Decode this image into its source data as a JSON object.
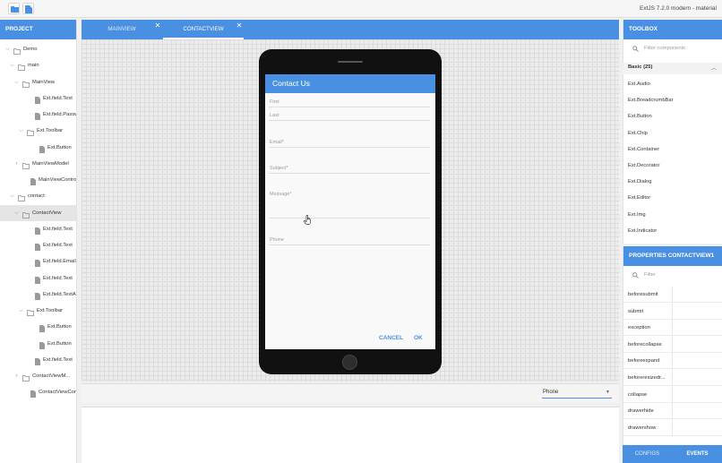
{
  "app": {
    "title": "ExtJS 7.2.0 modern - material"
  },
  "project": {
    "header": "PROJECT",
    "tree": [
      {
        "label": "Demo",
        "level": 0,
        "kind": "folder",
        "expanded": true
      },
      {
        "label": "main",
        "level": 1,
        "kind": "folder",
        "expanded": true
      },
      {
        "label": "MainView",
        "level": 2,
        "kind": "folder",
        "expanded": true
      },
      {
        "label": "Ext.field.Text",
        "level": 3,
        "kind": "file"
      },
      {
        "label": "Ext.field.Passw...",
        "level": 3,
        "kind": "file"
      },
      {
        "label": "Ext.Toolbar",
        "level": 3,
        "kind": "folder",
        "expanded": true
      },
      {
        "label": "Ext.Button",
        "level": 4,
        "kind": "file"
      },
      {
        "label": "MainViewModel",
        "level": 2,
        "kind": "folder",
        "expanded": false
      },
      {
        "label": "MainViewController",
        "level": 2,
        "kind": "file"
      },
      {
        "label": "contact",
        "level": 1,
        "kind": "folder",
        "expanded": true
      },
      {
        "label": "ContactView",
        "level": 2,
        "kind": "folder",
        "expanded": true,
        "selected": true
      },
      {
        "label": "Ext.field.Text",
        "level": 3,
        "kind": "file"
      },
      {
        "label": "Ext.field.Text",
        "level": 3,
        "kind": "file"
      },
      {
        "label": "Ext.field.Email",
        "level": 3,
        "kind": "file"
      },
      {
        "label": "Ext.field.Text",
        "level": 3,
        "kind": "file"
      },
      {
        "label": "Ext.field.TextArea",
        "level": 3,
        "kind": "file"
      },
      {
        "label": "Ext.Toolbar",
        "level": 3,
        "kind": "folder",
        "expanded": true
      },
      {
        "label": "Ext.Button",
        "level": 4,
        "kind": "file"
      },
      {
        "label": "Ext.Button",
        "level": 4,
        "kind": "file"
      },
      {
        "label": "Ext.field.Text",
        "level": 3,
        "kind": "file"
      },
      {
        "label": "ContactViewM...",
        "level": 2,
        "kind": "folder",
        "expanded": false
      },
      {
        "label": "ContactViewContr...",
        "level": 2,
        "kind": "file"
      }
    ]
  },
  "tabs": [
    {
      "label": "MAINVIEW",
      "active": false,
      "close": "✕"
    },
    {
      "label": "CONTACTVIEW",
      "active": true,
      "close": "✕"
    }
  ],
  "form": {
    "title": "Contact Us",
    "fields": [
      {
        "label": "First"
      },
      {
        "label": "Last"
      },
      {
        "label": "Email*"
      },
      {
        "label": "Subject*"
      },
      {
        "label": "Message*"
      },
      {
        "label": "Phone"
      }
    ],
    "cancel_label": "CANCEL",
    "ok_label": "OK"
  },
  "device_select": {
    "value": "Phone",
    "arrow": "▼"
  },
  "toolbox": {
    "header": "TOOLBOX",
    "filter_placeholder": "Filter components",
    "group_label": "Basic (25)",
    "group_chevron": "︿",
    "items": [
      "Ext.Audio",
      "Ext.BreadcrumbBar",
      "Ext.Button",
      "Ext.Chip",
      "Ext.Container",
      "Ext.Decorator",
      "Ext.Dialog",
      "Ext.Editor",
      "Ext.Img",
      "Ext.Indicator"
    ]
  },
  "properties": {
    "header": "PROPERTIES CONTACTVIEW1",
    "filter_placeholder": "Filter",
    "events": [
      "beforesubmit",
      "submit",
      "exception",
      "beforecollapse",
      "beforeexpand",
      "beforeresizedr...",
      "collapse",
      "drawerhide",
      "drawershow"
    ],
    "tab_configs": "CONFIGS",
    "tab_events": "EVENTS"
  },
  "colors": {
    "accent": "#4a90e2"
  }
}
